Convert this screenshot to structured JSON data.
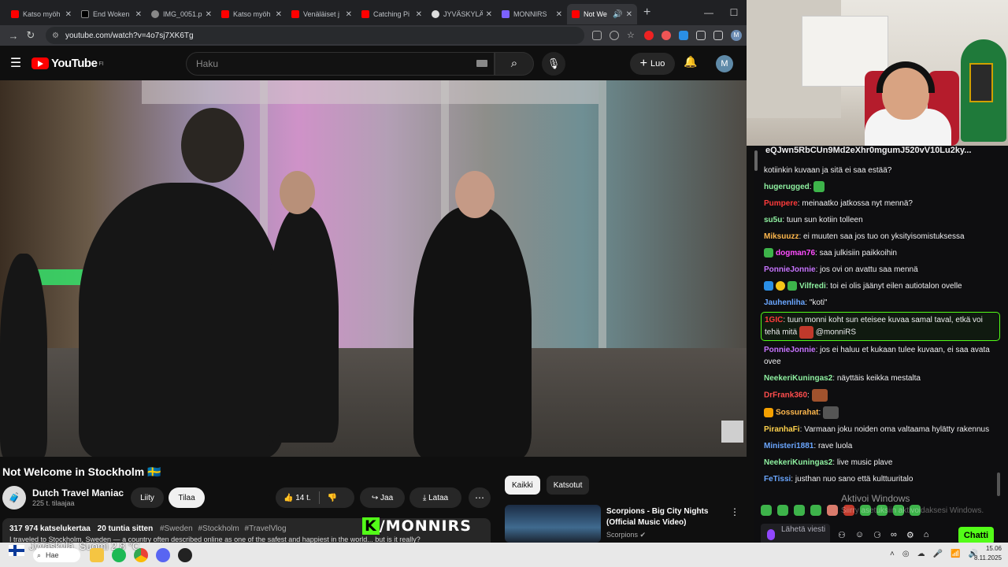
{
  "browser": {
    "tabs": [
      {
        "label": "Katso myöh",
        "color": "#ff0000"
      },
      {
        "label": "End Woken",
        "color": "#000000"
      },
      {
        "label": "IMG_0051.p",
        "color": "#888888"
      },
      {
        "label": "Katso myöh",
        "color": "#ff0000"
      },
      {
        "label": "Venäläiset j",
        "color": "#ff0000"
      },
      {
        "label": "Catching Pi",
        "color": "#ff0000"
      },
      {
        "label": "JYVÄSKYLÄ",
        "color": "#aaaaaa"
      },
      {
        "label": "MONNIRS",
        "color": "#7b61ff"
      },
      {
        "label": "Not We",
        "color": "#ff0000"
      }
    ],
    "url": "youtube.com/watch?v=4o7sj7XK6Tg"
  },
  "youtube": {
    "logo_text": "YouTube",
    "logo_region": "FI",
    "search_placeholder": "Haku",
    "create_label": "Luo",
    "avatar_letter": "M",
    "video_title": "Not Welcome in Stockholm 🇸🇪",
    "channel": {
      "name": "Dutch Travel Maniac",
      "subscribers": "225 t. tilaajaa",
      "avatar": "🧳"
    },
    "join_label": "Liity",
    "subscribe_label": "Tilaa",
    "likes": "14 t.",
    "share_label": "Jaa",
    "download_label": "Lataa",
    "views": "317 974 katselukertaa",
    "age": "20 tuntia sitten",
    "tags": [
      "#Sweden",
      "#Stockholm",
      "#TravelVlog"
    ],
    "description": "I traveled to Stockholm, Sweden — a country often described online as one of the safest and happiest in the world... but is it really?",
    "overlay_logo": "/MONNIRS",
    "overlay_k": "K",
    "chips": [
      "Kaikki",
      "Katsotut"
    ],
    "recommendation": {
      "title": "Scorpions - Big City Nights (Official Music Video)",
      "channel": "Scorpions ✔"
    }
  },
  "chat": {
    "top_line": "eQJwn5RbCUn9Md2eXhr0mgumJ520vV10Lu2ky...",
    "messages": [
      {
        "user": "",
        "color": "#efeff1",
        "text": "kotiinkin kuvaan ja sitä ei saa estää?"
      },
      {
        "user": "hugerugged",
        "color": "#8ef0a0",
        "text": ""
      },
      {
        "user": "Pumpere",
        "color": "#ff3b3b",
        "text": "meinaatko jatkossa nyt mennä?"
      },
      {
        "user": "su5u",
        "color": "#8ef0a0",
        "text": "tuun sun kotiin tolleen"
      },
      {
        "user": "Miksuuzz",
        "color": "#ffb84d",
        "text": "ei muuten saa jos tuo on yksityisomistuksessa"
      },
      {
        "user": "dogman76",
        "color": "#ff4dff",
        "text": "saa julkisiin paikkoihin"
      },
      {
        "user": "PonnieJonnie",
        "color": "#c773ff",
        "text": "jos ovi on avattu saa mennä"
      },
      {
        "user": "Vilfredi",
        "color": "#8ef0a0",
        "text": "toi ei olis jäänyt eilen autiotalon ovelle"
      },
      {
        "user": "Jauhenliha",
        "color": "#6aa6ff",
        "text": "\"koti\""
      },
      {
        "user": "1GIC",
        "color": "#ff3b3b",
        "text": "tuun monni koht sun eteisee kuvaa samal taval, etkä voi tehä mitä",
        "mention": "@monniRS"
      },
      {
        "user": "PonnieJonnie",
        "color": "#c773ff",
        "text": "jos ei haluu et kukaan tulee kuvaan, ei saa avata ovee"
      },
      {
        "user": "NeekeriKuningas2",
        "color": "#8ef0a0",
        "text": "näyttäis keikka mestalta"
      },
      {
        "user": "DrFrank360",
        "color": "#ff4d4d",
        "text": ""
      },
      {
        "user": "Sossurahat",
        "color": "#ffb84d",
        "text": ""
      },
      {
        "user": "PiranhaFi",
        "color": "#ffd24d",
        "text": "Varmaan joku noiden oma valtaama hylätty rakennus"
      },
      {
        "user": "Ministeri1881",
        "color": "#6aa6ff",
        "text": "rave luola"
      },
      {
        "user": "NeekeriKuningas2",
        "color": "#8ef0a0",
        "text": "live music plave"
      },
      {
        "user": "FeTissi",
        "color": "#6aa6ff",
        "text": "justhan nuo sano että kulttuuritalo"
      }
    ],
    "input_placeholder": "Lähetä viesti",
    "send_label": "Chatti",
    "windows_watermark_1": "Aktivoi Windows",
    "windows_watermark_2": "Siirry asetuksiin aktivoidaksesi Windows."
  },
  "taskbar": {
    "weather": "Jyväskylä, Suomi  2,8 °C",
    "search": "Hae",
    "time": "15.06",
    "date": "8.11.2025"
  }
}
